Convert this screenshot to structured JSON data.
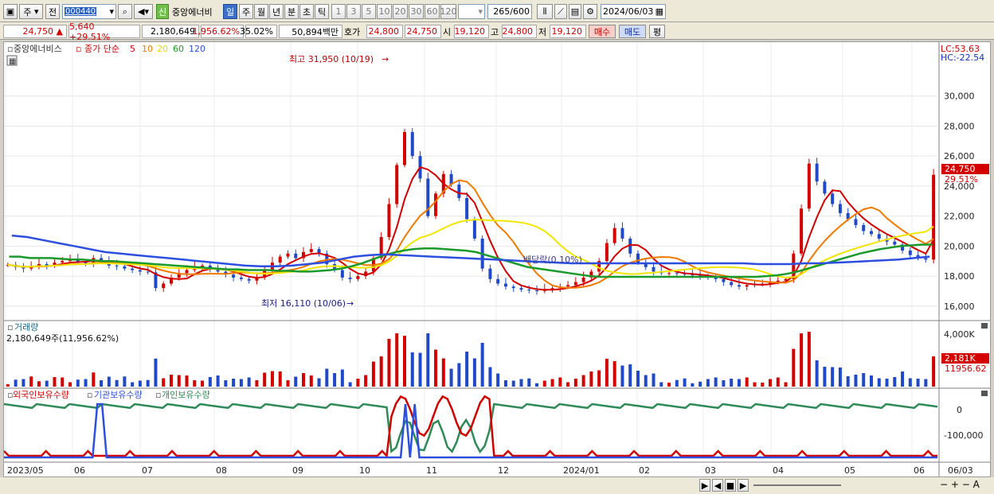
{
  "toolbar": {
    "tab_label": "주",
    "prev_label": "전",
    "code": "000440",
    "sin_badge": "신",
    "stock_name": "중앙에너비",
    "periods": [
      "일",
      "주",
      "월",
      "년",
      "분",
      "초",
      "틱"
    ],
    "period_selected": "일",
    "intervals": [
      "1",
      "3",
      "5",
      "10",
      "20",
      "30",
      "60",
      "120"
    ],
    "count": "265",
    "count_total": "/600",
    "date": "2024/06/03"
  },
  "quote": {
    "price": "24,750",
    "change": "5,640 +29.51%",
    "volume": "2,180,649",
    "volume_pct": "1,956.62%",
    "turnover_pct": "35.02%",
    "amount": "50,894백만",
    "hoga_label": "호가",
    "hoga": "24,800",
    "ask": "24,750",
    "open_label": "시",
    "open": "19,120",
    "high_label": "고",
    "high": "24,800",
    "low_label": "저",
    "low": "19,120",
    "buy_label": "매수",
    "sell_label": "매도",
    "avg_label": "평"
  },
  "colors": {
    "up": "#d40000",
    "down": "#1f49c9",
    "ma5": "#d40000",
    "ma10": "#f07a00",
    "ma20": "#f2e600",
    "ma60": "#1a9a2a",
    "ma120": "#2d4fe0",
    "foreign": "#d40000",
    "institution": "#2d4fe0",
    "individual": "#2e8b57"
  },
  "price_panel": {
    "legend_name": "중앙에너비스",
    "legend_series": "종가 단순",
    "ma_periods": [
      "5",
      "10",
      "20",
      "60",
      "120"
    ],
    "lc": "LC:53.63",
    "hc": "HC:-22.54",
    "high_annotation": "최고 31,950 (10/19)",
    "low_annotation": "최저 16,110 (10/06)",
    "dividend_annotation": "배당락(0.10%)",
    "current_price": "24,750",
    "current_change": "29.51%",
    "y_ticks": [
      "30,000",
      "28,000",
      "26,000",
      "24,000",
      "22,000",
      "20,000",
      "18,000",
      "16,000"
    ]
  },
  "volume_panel": {
    "title": "거래량",
    "value": "2,180,649주(11,956.62%)",
    "y_tick": "4,000K",
    "current": "2,181K",
    "current_pct": "11956.62"
  },
  "holdings_panel": {
    "series": [
      "외국인보유수량",
      "기관보유수량",
      "개인보유수량"
    ],
    "y_ticks": [
      "0",
      "-100,000"
    ]
  },
  "x_axis": {
    "labels": [
      "2023/05",
      "06",
      "07",
      "08",
      "09",
      "10",
      "11",
      "12",
      "2024/01",
      "02",
      "03",
      "04",
      "05",
      "06"
    ],
    "right_label": "06/03"
  },
  "chart_data": {
    "type": "candlestick",
    "ylim": [
      15000,
      32000
    ],
    "series_close": [
      18750,
      18600,
      18500,
      18650,
      18800,
      18700,
      18900,
      19000,
      19100,
      18950,
      18850,
      19200,
      19000,
      18700,
      18650,
      18500,
      18400,
      18300,
      18250,
      17200,
      17500,
      17900,
      18200,
      18400,
      18600,
      18700,
      18500,
      18300,
      18100,
      17900,
      17800,
      17700,
      17900,
      18400,
      18900,
      19300,
      19500,
      19200,
      19600,
      19800,
      19500,
      18800,
      18400,
      17900,
      17800,
      18000,
      18300,
      19200,
      20600,
      22800,
      25400,
      27600,
      26000,
      24500,
      22000,
      23500,
      24800,
      24100,
      23200,
      21800,
      20500,
      18500,
      17800,
      17500,
      17300,
      17200,
      17100,
      17050,
      17000,
      17100,
      17200,
      17300,
      17400,
      17600,
      17900,
      18300,
      19000,
      20200,
      21200,
      20500,
      19500,
      18900,
      18600,
      18300,
      18200,
      18200,
      18150,
      18100,
      18050,
      18000,
      17900,
      17800,
      17600,
      17400,
      17300,
      17400,
      17500,
      17500,
      17600,
      17700,
      17800,
      19500,
      22500,
      25500,
      24300,
      23500,
      22800,
      22200,
      21800,
      21400,
      21000,
      20800,
      20500,
      20300,
      20100,
      19700,
      19400,
      19200,
      19100,
      24750
    ],
    "ma60": [
      19300,
      19300,
      19200,
      19200,
      19200,
      19150,
      19100,
      19100,
      19050,
      19000,
      19000,
      18950,
      18900,
      18850,
      18800,
      18750,
      18700,
      18650,
      18600,
      18550,
      18500,
      18450,
      18450,
      18400,
      18400,
      18400,
      18350,
      18350,
      18300,
      18300,
      18350,
      18400,
      18500,
      18650,
      18850,
      19100,
      19350,
      19550,
      19700,
      19800,
      19850,
      19850,
      19800,
      19750,
      19700,
      19600,
      19400,
      19200,
      19000,
      18800,
      18600,
      18500,
      18400,
      18300,
      18200,
      18100,
      18000,
      17950,
      17950,
      17950,
      17950,
      17950,
      17950,
      17950,
      17950,
      17950,
      17950,
      17950,
      17950,
      17950,
      17950,
      17950,
      17950,
      18000,
      18050,
      18150,
      18300,
      18500,
      18700,
      18900,
      19100,
      19300,
      19500,
      19650,
      19800,
      19900,
      20000,
      20050,
      20100,
      20100
    ],
    "ma120": [
      20700,
      20600,
      20400,
      20200,
      20000,
      19800,
      19600,
      19500,
      19400,
      19300,
      19200,
      19100,
      19000,
      18900,
      18800,
      18700,
      18650,
      18650,
      18700,
      18800,
      18900,
      19100,
      19300,
      19400,
      19450,
      19400,
      19350,
      19300,
      19250,
      19200,
      19150,
      19100,
      19050,
      19000,
      18950,
      18900,
      18850,
      18850,
      18850,
      18850,
      18850,
      18850,
      18850,
      18850,
      18850,
      18850,
      18850,
      18850,
      18800,
      18800,
      18800,
      18850,
      18850,
      18900,
      18950,
      19000,
      19050,
      19100,
      19200,
      19300
    ]
  }
}
